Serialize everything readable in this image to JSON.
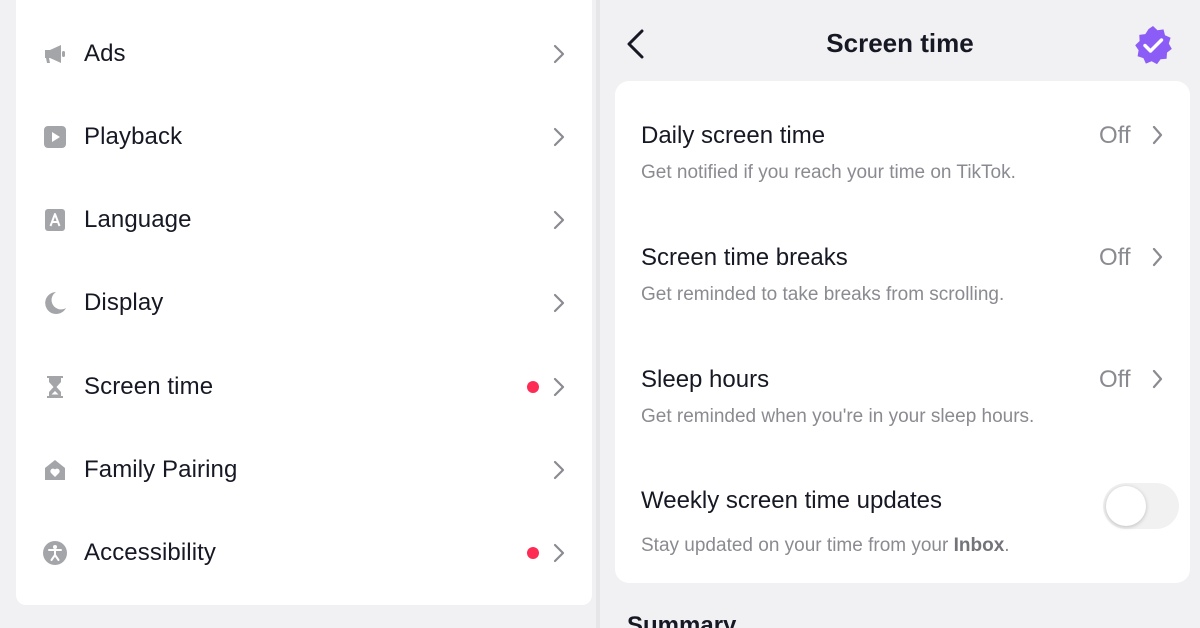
{
  "left_menu": {
    "items": [
      {
        "label": "Ads",
        "icon": "megaphone-icon",
        "dot": false
      },
      {
        "label": "Playback",
        "icon": "play-icon",
        "dot": false
      },
      {
        "label": "Language",
        "icon": "language-icon",
        "dot": false
      },
      {
        "label": "Display",
        "icon": "moon-icon",
        "dot": false
      },
      {
        "label": "Screen time",
        "icon": "hourglass-icon",
        "dot": true
      },
      {
        "label": "Family Pairing",
        "icon": "home-heart-icon",
        "dot": false
      },
      {
        "label": "Accessibility",
        "icon": "accessibility-icon",
        "dot": true
      }
    ]
  },
  "screen_time": {
    "title": "Screen time",
    "settings": [
      {
        "title": "Daily screen time",
        "description": "Get notified if you reach your time on TikTok.",
        "value": "Off"
      },
      {
        "title": "Screen time breaks",
        "description": "Get reminded to take breaks from scrolling.",
        "value": "Off"
      },
      {
        "title": "Sleep hours",
        "description": "Get reminded when you're in your sleep hours.",
        "value": "Off"
      }
    ],
    "weekly": {
      "title": "Weekly screen time updates",
      "description_prefix": "Stay updated on your time from your ",
      "description_link": "Inbox",
      "description_suffix": ".",
      "enabled": false
    },
    "summary_heading": "Summary"
  },
  "colors": {
    "notification_dot": "#fe2c55",
    "badge": "#8b5cf6",
    "icon_gray": "#a4a5a9",
    "text_primary": "#161823",
    "text_secondary": "#8a8b91"
  }
}
